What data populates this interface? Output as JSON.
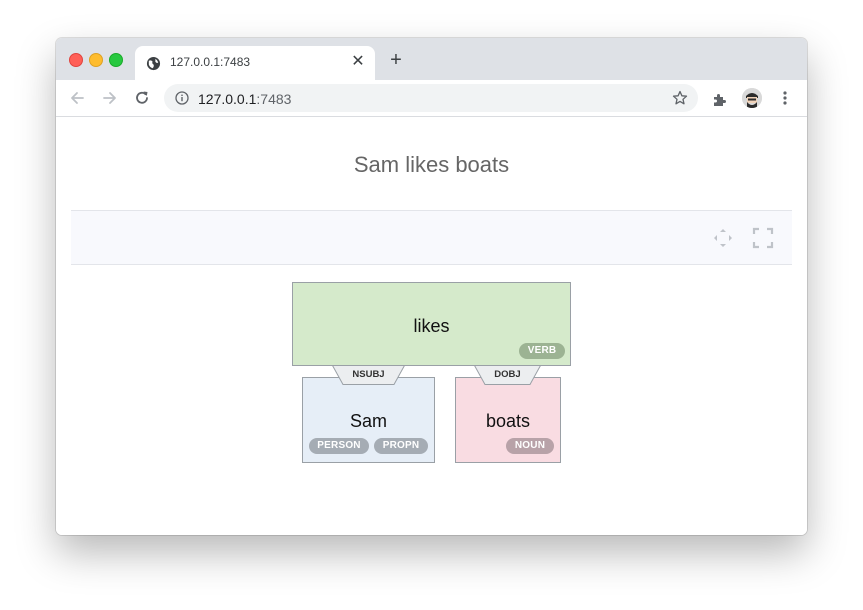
{
  "browser": {
    "tab_title": "127.0.0.1:7483",
    "url_host": "127.0.0.1",
    "url_port": ":7483"
  },
  "page": {
    "title": "Sam likes boats"
  },
  "graph": {
    "root": {
      "word": "likes",
      "tags": [
        "VERB"
      ]
    },
    "children": [
      {
        "word": "Sam",
        "relation": "NSUBJ",
        "tags": [
          "PERSON",
          "PROPN"
        ]
      },
      {
        "word": "boats",
        "relation": "DOBJ",
        "tags": [
          "NOUN"
        ]
      }
    ]
  },
  "colors": {
    "verb_bg": "#d5eacb",
    "noun_bg": "#f9dce2",
    "propn_bg": "#e6eef7",
    "tag_verb": "#9cb393",
    "tag_person_propn": "#a5acb4",
    "tag_noun": "#b8a2a8"
  },
  "icons": {
    "toolbar": [
      "back-icon",
      "forward-icon",
      "reload-icon",
      "info-icon",
      "star-icon",
      "extensions-icon",
      "avatar",
      "menu-icon"
    ],
    "graph_toolbar": [
      "fit-to-view-icon",
      "fullscreen-icon"
    ]
  }
}
